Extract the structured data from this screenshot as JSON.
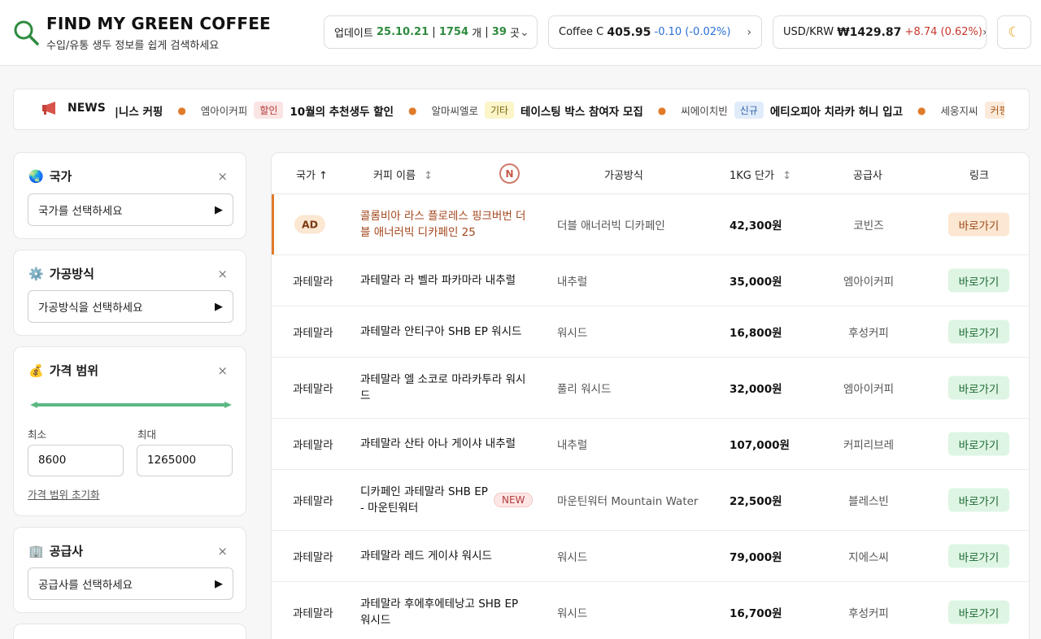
{
  "header": {
    "title": "FIND MY GREEN COFFEE",
    "subtitle": "수입/유통 생두 정보를 쉽게 검색하세요",
    "update": {
      "label": "업데이트",
      "date": "25.10.21",
      "sep1": "|",
      "count": "1754",
      "count_unit": "개",
      "sep2": "|",
      "places": "39",
      "places_unit": "곳"
    },
    "coffee_c": {
      "label": "Coffee C",
      "value": "405.95",
      "change": "-0.10",
      "pct": "(-0.02%)"
    },
    "usdkrw": {
      "label": "USD/KRW",
      "value": "₩1429.87",
      "change": "+8.74",
      "pct": "(0.62%)"
    },
    "theme_icon": "moon-icon"
  },
  "news": {
    "label": "NEWS",
    "items": [
      {
        "source": "",
        "tag": "",
        "title": "|니스 커핑"
      },
      {
        "source": "엠아이커피",
        "tag": "할인",
        "title": "10월의 추천생두 할인"
      },
      {
        "source": "알마씨엘로",
        "tag": "기타",
        "title": "테이스팅 박스 참여자 모집"
      },
      {
        "source": "씨에이치빈",
        "tag": "신규",
        "title": "에티오피아 치라카 허니 입고"
      },
      {
        "source": "세웅지씨",
        "tag": "커핑",
        "title": ""
      }
    ]
  },
  "filters": {
    "country": {
      "title": "국가",
      "placeholder": "국가를 선택하세요"
    },
    "process": {
      "title": "가공방식",
      "placeholder": "가공방식을 선택하세요"
    },
    "price": {
      "title": "가격 범위",
      "min_label": "최소",
      "max_label": "최대",
      "min_value": "8600",
      "max_value": "1265000",
      "reset": "가격 범위 초기화",
      "min_fraction": 0.0,
      "max_fraction": 1.0
    },
    "supplier": {
      "title": "공급사",
      "placeholder": "공급사를 선택하세요"
    },
    "close": "×"
  },
  "table": {
    "headers": {
      "country": "국가 ↑",
      "name": "커피 이름",
      "process": "가공방식",
      "price": "1KG 단가",
      "supplier": "공급사",
      "link": "링크",
      "n_badge": "N"
    },
    "go_label": "바로가기",
    "ad_label": "AD",
    "new_label": "NEW",
    "rows": [
      {
        "ad": true,
        "country": "",
        "name": "콜롬비아 라스 플로레스 핑크버번 더블 애너러빅 디카페인 25",
        "process": "더블 애너러빅 디카페인",
        "price": "42,300원",
        "supplier": "코빈즈"
      },
      {
        "ad": false,
        "country": "과테말라",
        "name": "과테말라 라 벨라 파카마라 내추럴",
        "process": "내추럴",
        "price": "35,000원",
        "supplier": "엠아이커피"
      },
      {
        "ad": false,
        "country": "과테말라",
        "name": "과테말라 안티구아 SHB EP 워시드",
        "process": "워시드",
        "price": "16,800원",
        "supplier": "후성커피"
      },
      {
        "ad": false,
        "country": "과테말라",
        "name": "과테말라 엘 소코로 마라카투라 워시드",
        "process": "풀리 워시드",
        "price": "32,000원",
        "supplier": "엠아이커피"
      },
      {
        "ad": false,
        "country": "과테말라",
        "name": "과테말라 산타 아나 게이샤 내추럴",
        "process": "내추럴",
        "price": "107,000원",
        "supplier": "커피리브레"
      },
      {
        "ad": false,
        "new": true,
        "country": "과테말라",
        "name": "디카페인 과테말라 SHB EP - 마운틴워터",
        "process": "마운틴워터 Mountain Water",
        "price": "22,500원",
        "supplier": "블레스빈"
      },
      {
        "ad": false,
        "country": "과테말라",
        "name": "과테말라 레드 게이샤 워시드",
        "process": "워시드",
        "price": "79,000원",
        "supplier": "지에스씨"
      },
      {
        "ad": false,
        "country": "과테말라",
        "name": "과테말라 후에후에테낭고 SHB EP 워시드",
        "process": "워시드",
        "price": "16,700원",
        "supplier": "후성커피"
      }
    ]
  },
  "colors": {
    "accent_green": "#2e8b3e",
    "ad_orange": "#e07b2a",
    "range_green": "#5cb884"
  }
}
